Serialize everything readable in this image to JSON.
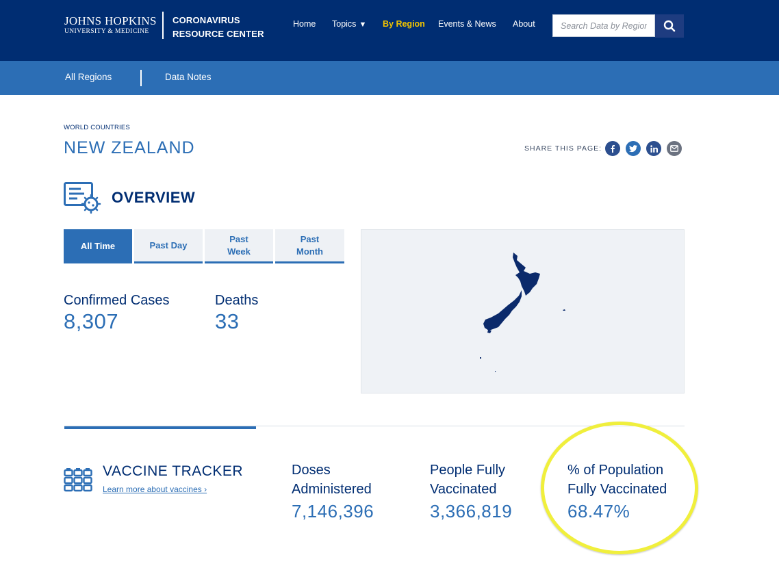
{
  "header": {
    "logo_line1": "JOHNS HOPKINS",
    "logo_line2": "UNIVERSITY & MEDICINE",
    "site_line1": "CORONAVIRUS",
    "site_line2": "RESOURCE CENTER",
    "nav": {
      "home": "Home",
      "topics": "Topics",
      "topics_caret": "▼",
      "by_region": "By Region",
      "events": "Events & News",
      "about": "About"
    },
    "search_placeholder": "Search Data by Region"
  },
  "subnav": {
    "all_regions": "All Regions",
    "data_notes": "Data Notes"
  },
  "breadcrumb": "WORLD COUNTRIES",
  "page_title": "NEW ZEALAND",
  "share": {
    "label": "SHARE THIS PAGE:",
    "icons": [
      "facebook-icon",
      "twitter-icon",
      "linkedin-icon",
      "email-icon"
    ]
  },
  "overview": {
    "title": "OVERVIEW",
    "tabs": [
      {
        "label": "All Time",
        "active": true
      },
      {
        "label": "Past Day",
        "active": false
      },
      {
        "label": "Past Week",
        "active": false
      },
      {
        "label": "Past Month",
        "active": false
      }
    ],
    "stats": {
      "cases_label": "Confirmed Cases",
      "cases_value": "8,307",
      "deaths_label": "Deaths",
      "deaths_value": "33"
    }
  },
  "vaccine": {
    "title": "VACCINE TRACKER",
    "link": "Learn more about vaccines ›",
    "doses_label": "Doses Administered",
    "doses_value": "7,146,396",
    "people_label": "People Fully Vaccinated",
    "people_value": "3,366,819",
    "pct_label": "% of Population Fully Vaccinated",
    "pct_value": "68.47%"
  },
  "colors": {
    "navy": "#002d72",
    "blue": "#2c6eb5",
    "gold": "#f1c400",
    "highlight": "#f0ef3c",
    "map_bg": "#eff2f6"
  }
}
